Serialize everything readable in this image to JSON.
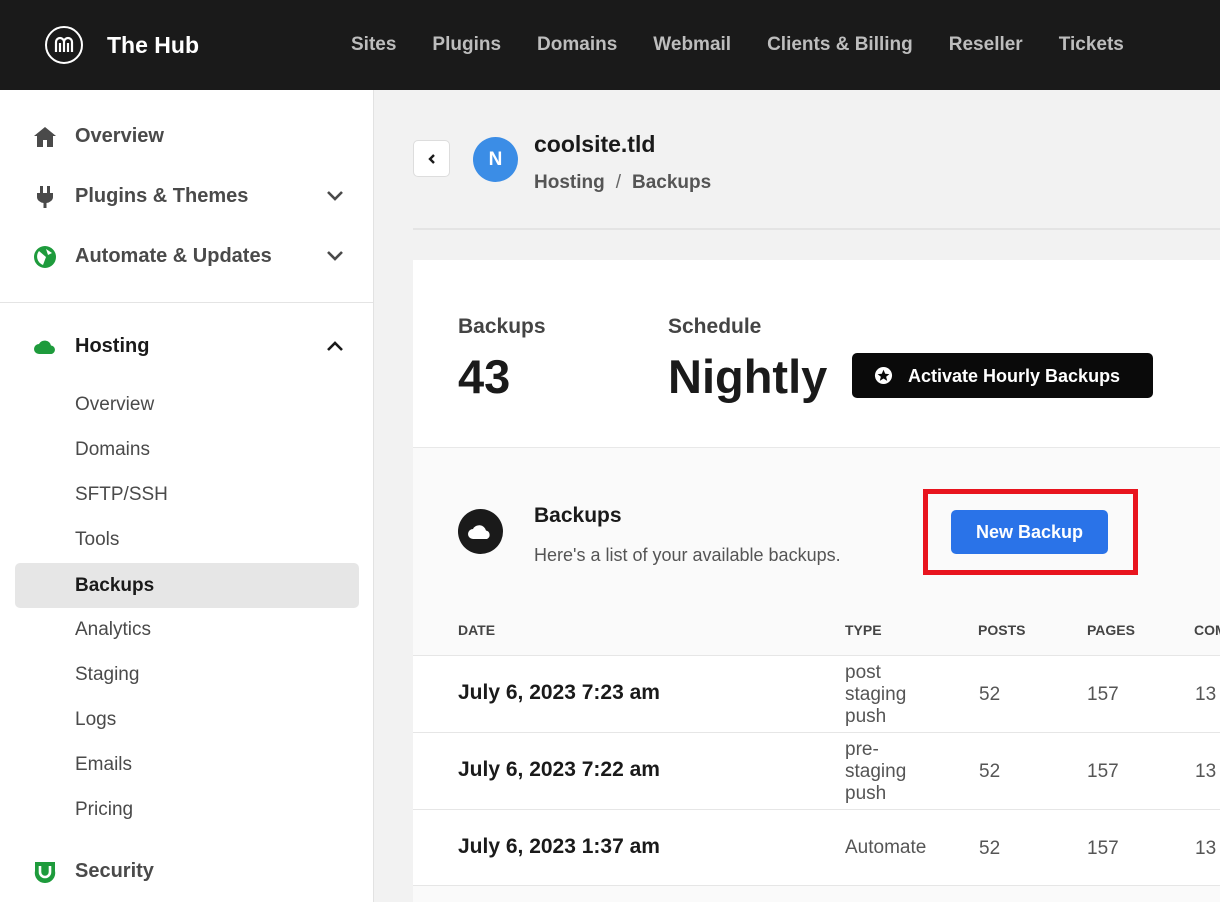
{
  "app": {
    "brand": "The Hub"
  },
  "topnav": [
    "Sites",
    "Plugins",
    "Domains",
    "Webmail",
    "Clients & Billing",
    "Reseller",
    "Tickets"
  ],
  "sidebar": {
    "top_items": [
      {
        "label": "Overview",
        "icon": "home-icon"
      },
      {
        "label": "Plugins & Themes",
        "icon": "plug-icon"
      },
      {
        "label": "Automate & Updates",
        "icon": "automate-icon"
      }
    ],
    "hosting": {
      "label": "Hosting",
      "icon": "cloud-icon"
    },
    "sub_items": [
      "Overview",
      "Domains",
      "SFTP/SSH",
      "Tools",
      "Backups",
      "Analytics",
      "Staging",
      "Logs",
      "Emails",
      "Pricing"
    ],
    "active_sub": "Backups",
    "security": {
      "label": "Security",
      "icon": "shield-icon"
    }
  },
  "header": {
    "avatar_initial": "N",
    "site": "coolsite.tld",
    "breadcrumb": [
      "Hosting",
      "Backups"
    ],
    "breadcrumb_sep": "/"
  },
  "summary": {
    "backups_label": "Backups",
    "backups_count": "43",
    "schedule_label": "Schedule",
    "schedule_value": "Nightly",
    "hourly_button": "Activate Hourly Backups"
  },
  "backups_section": {
    "title": "Backups",
    "description": "Here's a list of your available backups.",
    "new_button": "New Backup"
  },
  "table": {
    "headers": [
      "DATE",
      "TYPE",
      "POSTS",
      "PAGES",
      "COM"
    ],
    "rows": [
      {
        "date": "July 6, 2023 7:23 am",
        "type": "post staging push",
        "posts": "52",
        "pages": "157",
        "comments": "13"
      },
      {
        "date": "July 6, 2023 7:22 am",
        "type": "pre-staging push",
        "posts": "52",
        "pages": "157",
        "comments": "13"
      },
      {
        "date": "July 6, 2023 1:37 am",
        "type": "Automate",
        "posts": "52",
        "pages": "157",
        "comments": "13"
      }
    ]
  },
  "colors": {
    "topbar": "#1a1a1a",
    "accent_blue": "#2a73e8",
    "highlight_red": "#e8141e",
    "brand_green": "#1e9b3c"
  }
}
